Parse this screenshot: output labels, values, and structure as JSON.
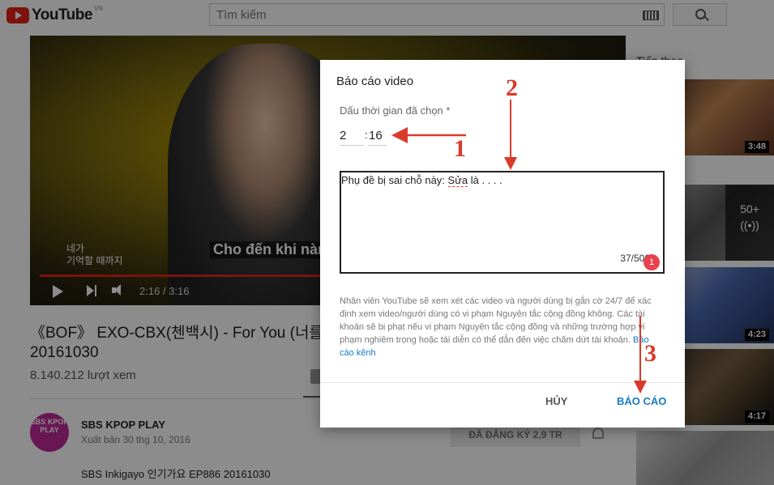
{
  "header": {
    "logo_text": "YouTube",
    "country": "VN",
    "search_placeholder": "Tìm kiếm",
    "icons": [
      "youtube-logo-icon",
      "keyboard-icon",
      "search-icon"
    ]
  },
  "player": {
    "subtitle_ko_line1": "네가",
    "subtitle_ko_line2": "기억할 때까지",
    "subtitle_vi": "Cho đến khi nàng",
    "time_display": "2:16 / 3:16",
    "progress_fraction": 0.68,
    "icons": [
      "play-icon",
      "next-icon",
      "volume-icon"
    ]
  },
  "video": {
    "title": "《BOF》 EXO-CBX(첸백시) - For You (너를 위",
    "title_line2": "20161030",
    "views": "8.140.212 lượt xem"
  },
  "channel": {
    "avatar_text": "SBS KPOP PLAY",
    "name": "SBS KPOP PLAY",
    "published": "Xuất bản 30 thg 10, 2016",
    "description": "SBS Inkigayo 인기가요 EP886 20161030",
    "subscribe_label": "ĐÃ ĐĂNG KÝ   2,9 TR"
  },
  "sidebar": {
    "up_next_label": "Tiếp theo",
    "thumbnails": [
      {
        "duration": "3:48"
      },
      {
        "overlay": "50+"
      },
      {
        "duration": "4:23"
      },
      {
        "duration": "4:17"
      },
      {
        "duration": ""
      }
    ]
  },
  "dialog": {
    "title": "Báo cáo video",
    "timestamp_label": "Dấu thời gian đã chọn *",
    "minutes": "2",
    "seconds": "16",
    "colon": ":",
    "comment_prefix": "Phụ đề bị sai chỗ này: ",
    "comment_misspelled": "Sửa",
    "comment_suffix": " là . . . .",
    "char_count": "37/500",
    "error_count": "1",
    "policy_text": "Nhân viên YouTube sẽ xem xét các video và người dùng bị gắn cờ 24/7 để xác định xem video/người dùng có vi phạm Nguyên tắc cộng đồng không. Các tài khoản sẽ bị phạt nếu vi phạm Nguyên tắc cộng đồng và những trường hợp vi phạm nghiêm trọng hoặc tái diễn có thể dẫn đến việc chấm dứt tài khoản.",
    "policy_link": "Báo cáo kênh",
    "cancel_label": "HỦY",
    "submit_label": "BÁO CÁO",
    "accent_color": "#167ac6"
  },
  "annotations": {
    "step1": "1",
    "step2": "2",
    "step3": "3",
    "color": "#d93a2b"
  }
}
